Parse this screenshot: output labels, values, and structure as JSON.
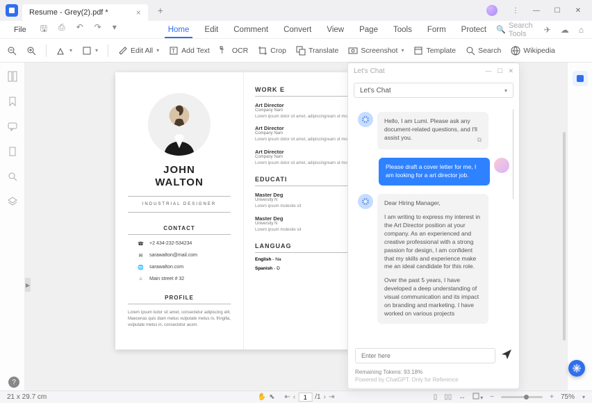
{
  "titlebar": {
    "tab_title": "Resume - Grey(2).pdf *"
  },
  "menubar": {
    "file": "File",
    "items": [
      "Home",
      "Edit",
      "Comment",
      "Convert",
      "View",
      "Page",
      "Tools",
      "Form",
      "Protect"
    ],
    "active_index": 0,
    "search_placeholder": "Search Tools"
  },
  "toolbar": {
    "edit_all": "Edit All",
    "add_text": "Add Text",
    "ocr": "OCR",
    "crop": "Crop",
    "translate": "Translate",
    "screenshot": "Screenshot",
    "template": "Template",
    "search": "Search",
    "wikipedia": "Wikipedia"
  },
  "document": {
    "name_first": "JOHN",
    "name_last": "WALTON",
    "subtitle": "INDUSTRIAL DESIGNER",
    "contact_h": "CONTACT",
    "phone": "+2 434-232-534234",
    "email": "sarawalton@mail.com",
    "website": "sarawalton.com",
    "address": "Main street # 32",
    "profile_h": "PROFILE",
    "profile_body": "Lorem ipsum kolor sit amet, consectetur adipiscing elit. Maecenas quis diam metus vulputate metus in, fringilla, vulputate metus in, consectetur auxm.",
    "work_h": "WORK E",
    "roles": [
      {
        "title": "Art Director",
        "company": "Company Nam",
        "body": "Lorem ipsum dolor sit amet, adipiscingream ut molestie sit amet."
      },
      {
        "title": "Art Director",
        "company": "Company Nam",
        "body": "Lorem ipsum dolor sit amet, adipiscingream ut molestie sit amet."
      },
      {
        "title": "Art Director",
        "company": "Company Nam",
        "body": "Lorem ipsum dolor sit amet, adipiscingream ut molestie sit amet."
      }
    ],
    "edu_h": "EDUCATI",
    "edu": [
      {
        "title": "Master Deg",
        "sub": "University N",
        "body": "Lorem ipsum molestie sit"
      },
      {
        "title": "Master Deg",
        "sub": "University N",
        "body": "Lorem ipsum molestie sit"
      }
    ],
    "lang_h": "LANGUAG",
    "langs": [
      {
        "name": "English",
        "level": "Na"
      },
      {
        "name": "Spanish",
        "level": "D"
      }
    ]
  },
  "chat": {
    "title": "Let's Chat",
    "dropdown": "Let's Chat",
    "messages": {
      "ai1": "Hello, I am Lumi. Please ask any document-related questions, and I'll assist you.",
      "user1": "Please draft a cover letter for me, I am looking for a art director job.",
      "ai2_greet": "Dear Hiring Manager,",
      "ai2_p1": "I am writing to express my interest in the Art Director position at your company. As an experienced and creative professional with a strong passion for design, I am confident that my skills and experience make me an ideal candidate for this role.",
      "ai2_p2": "Over the past 5 years, I have developed a deep understanding of visual communication and its impact on branding and marketing. I have worked on various projects"
    },
    "input_placeholder": "Enter here",
    "tokens": "Remaining Tokens: 93.18%",
    "powered": "Powered by ChatGPT. Only for Reference"
  },
  "statusbar": {
    "dimensions": "21 x 29.7 cm",
    "page_current": "1",
    "page_total": "/1",
    "zoom": "75%"
  }
}
